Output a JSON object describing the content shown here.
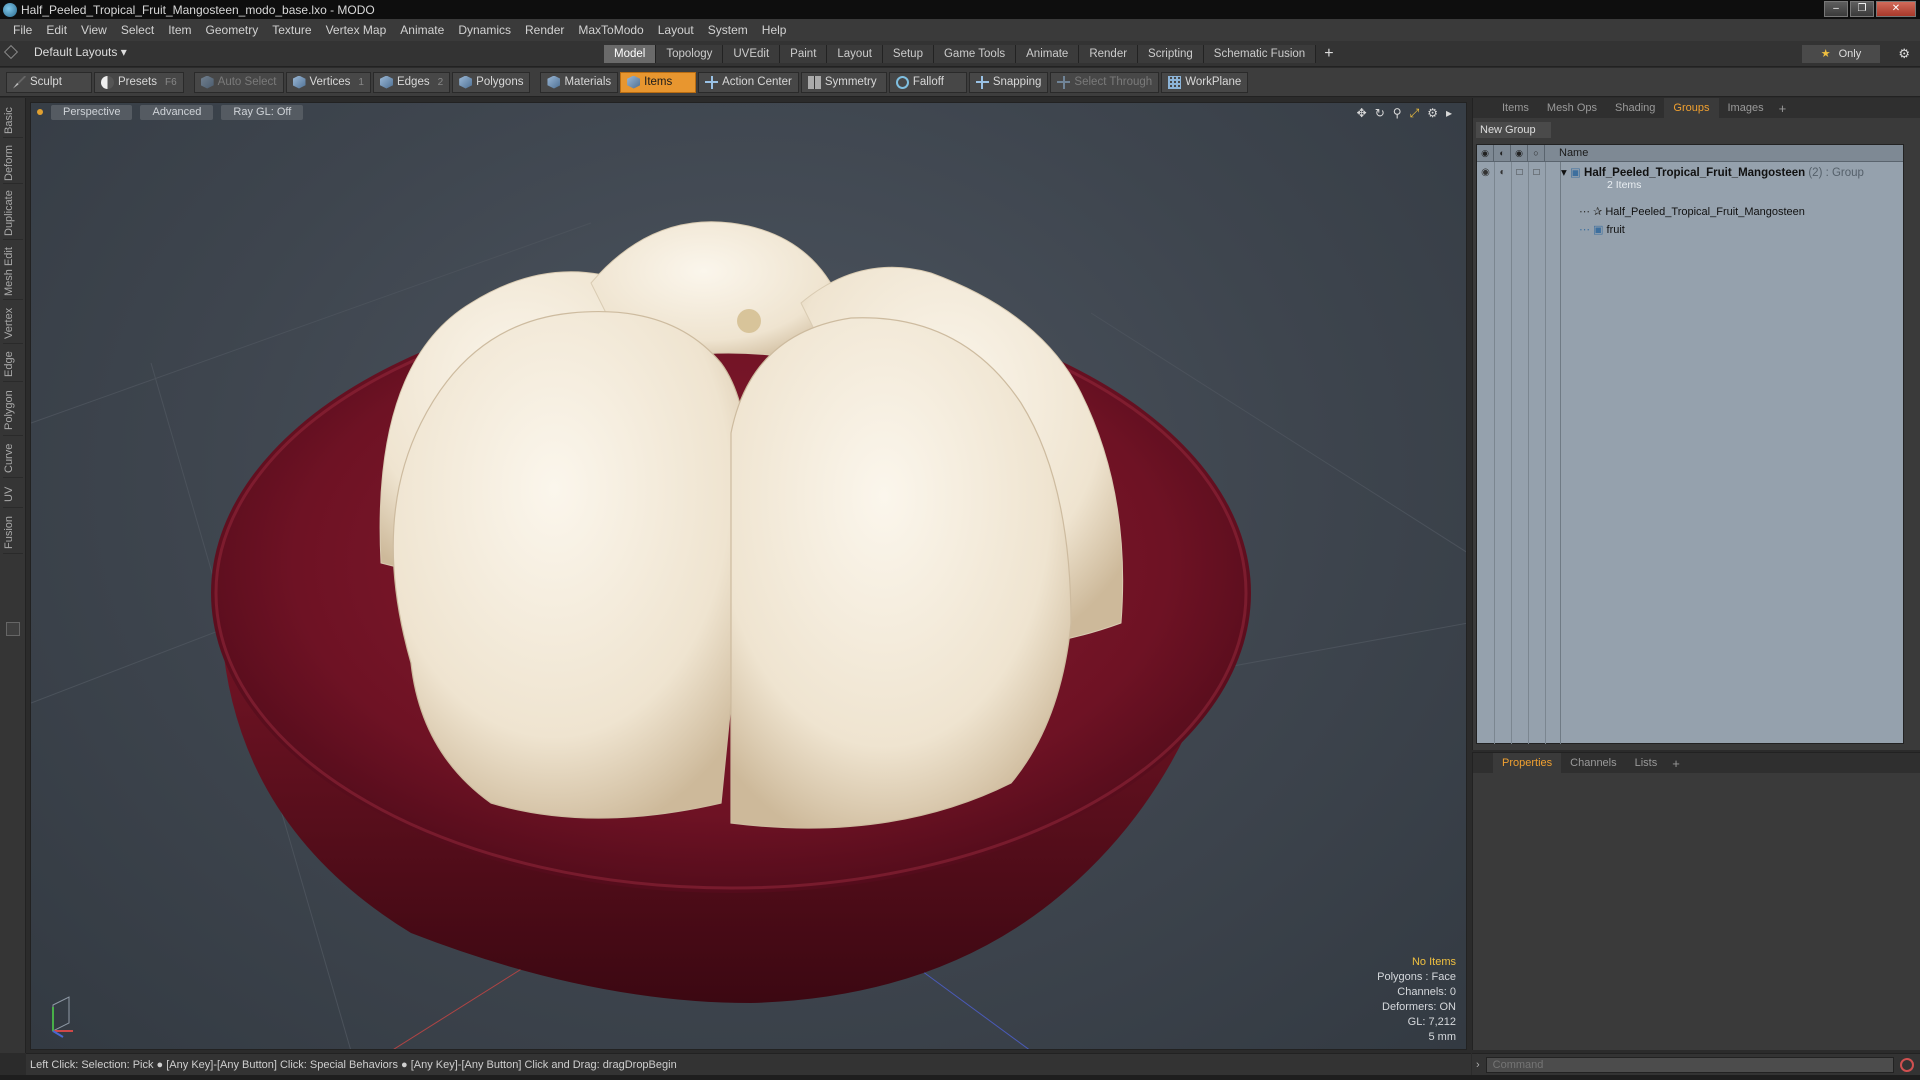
{
  "window": {
    "title": "Half_Peeled_Tropical_Fruit_Mangosteen_modo_base.lxo - MODO"
  },
  "menu": [
    "File",
    "Edit",
    "View",
    "Select",
    "Item",
    "Geometry",
    "Texture",
    "Vertex Map",
    "Animate",
    "Dynamics",
    "Render",
    "MaxToModo",
    "Layout",
    "System",
    "Help"
  ],
  "layout": {
    "dropdown": "Default Layouts",
    "tabs": [
      "Model",
      "Topology",
      "UVEdit",
      "Paint",
      "Layout",
      "Setup",
      "Game Tools",
      "Animate",
      "Render",
      "Scripting",
      "Schematic Fusion"
    ],
    "active_tab": "Model",
    "add": "+",
    "only_label": "Only"
  },
  "toolbar": {
    "sculpt": "Sculpt",
    "presets": "Presets",
    "presets_key": "F6",
    "auto_select": "Auto Select",
    "vertices": "Vertices",
    "vertices_key": "1",
    "edges": "Edges",
    "edges_key": "2",
    "polygons": "Polygons",
    "materials": "Materials",
    "items": "Items",
    "action_center": "Action Center",
    "symmetry": "Symmetry",
    "falloff": "Falloff",
    "snapping": "Snapping",
    "select_through": "Select Through",
    "workplane": "WorkPlane"
  },
  "left_tabs": [
    "Basic",
    "Deform",
    "Duplicate",
    "Mesh Edit",
    "Vertex",
    "Edge",
    "Polygon",
    "Curve",
    "UV",
    "Fusion"
  ],
  "viewport": {
    "view": "Perspective",
    "shading": "Advanced",
    "raygl": "Ray GL: Off",
    "info": {
      "selection": "No Items",
      "polygons": "Polygons : Face",
      "channels": "Channels: 0",
      "deformers": "Deformers: ON",
      "gl": "GL: 7,212",
      "unit": "5 mm"
    }
  },
  "groups_panel": {
    "tabs": [
      "Items",
      "Mesh Ops",
      "Shading",
      "Groups",
      "Images"
    ],
    "active_tab": "Groups",
    "new_group": "New Group",
    "name_header": "Name",
    "group": {
      "name": "Half_Peeled_Tropical_Fruit_Mangosteen",
      "meta": " (2) : Group",
      "count": "2 Items",
      "children": [
        "Half_Peeled_Tropical_Fruit_Mangosteen",
        "fruit"
      ]
    }
  },
  "props_panel": {
    "tabs": [
      "Properties",
      "Channels",
      "Lists"
    ],
    "active_tab": "Properties"
  },
  "status": {
    "text": "Left Click: Selection: Pick ● [Any Key]-[Any Button] Click: Special Behaviors ● [Any Key]-[Any Button] Click and Drag: dragDropBegin"
  },
  "command": {
    "placeholder": "Command"
  },
  "colors": {
    "accent": "#e8962f",
    "rind": "#7a1426",
    "flesh": "#f2eadb"
  }
}
